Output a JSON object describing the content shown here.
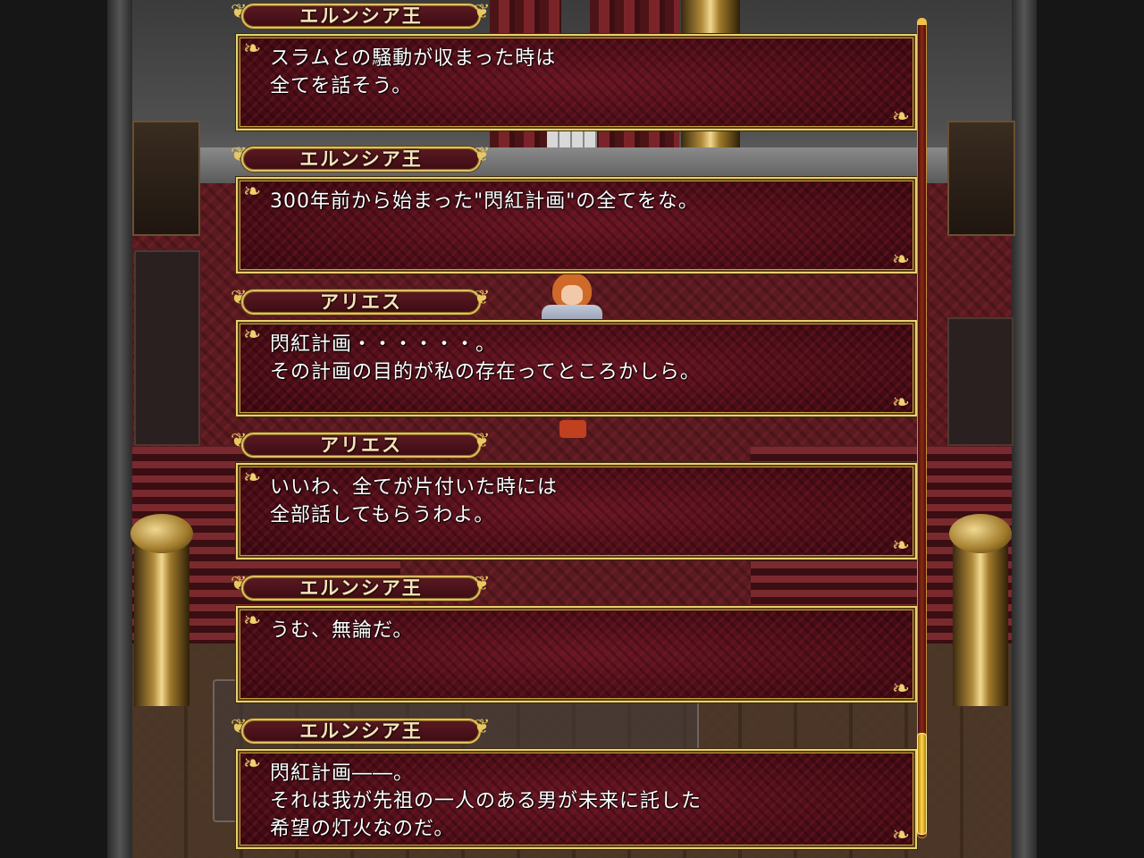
{
  "backlog": {
    "entries": [
      {
        "speaker": "エルンシア王",
        "lines": [
          "スラムとの騒動が収まった時は",
          "全てを話そう。"
        ]
      },
      {
        "speaker": "エルンシア王",
        "lines": [
          "300年前から始まった\"閃紅計画\"の全てをな。"
        ]
      },
      {
        "speaker": "アリエス",
        "lines": [
          "閃紅計画・・・・・・。",
          "その計画の目的が私の存在ってところかしら。"
        ]
      },
      {
        "speaker": "アリエス",
        "lines": [
          "いいわ、全てが片付いた時には",
          "全部話してもらうわよ。"
        ]
      },
      {
        "speaker": "エルンシア王",
        "lines": [
          "うむ、無論だ。"
        ]
      },
      {
        "speaker": "エルンシア王",
        "lines": [
          "閃紅計画――。",
          "それは我が先祖の一人のある男が未来に託した",
          "希望の灯火なのだ。"
        ]
      }
    ]
  },
  "scrollbar": {
    "position": 1.0
  },
  "colors": {
    "frame_gold": "#e8d070",
    "box_red": "#3e0a12",
    "name_text": "#f2e6b8",
    "scroll_thumb": "#ffd84a"
  },
  "icons": {
    "plate_ornament": "ornament-icon",
    "corner_flourish": "flourish-icon"
  }
}
